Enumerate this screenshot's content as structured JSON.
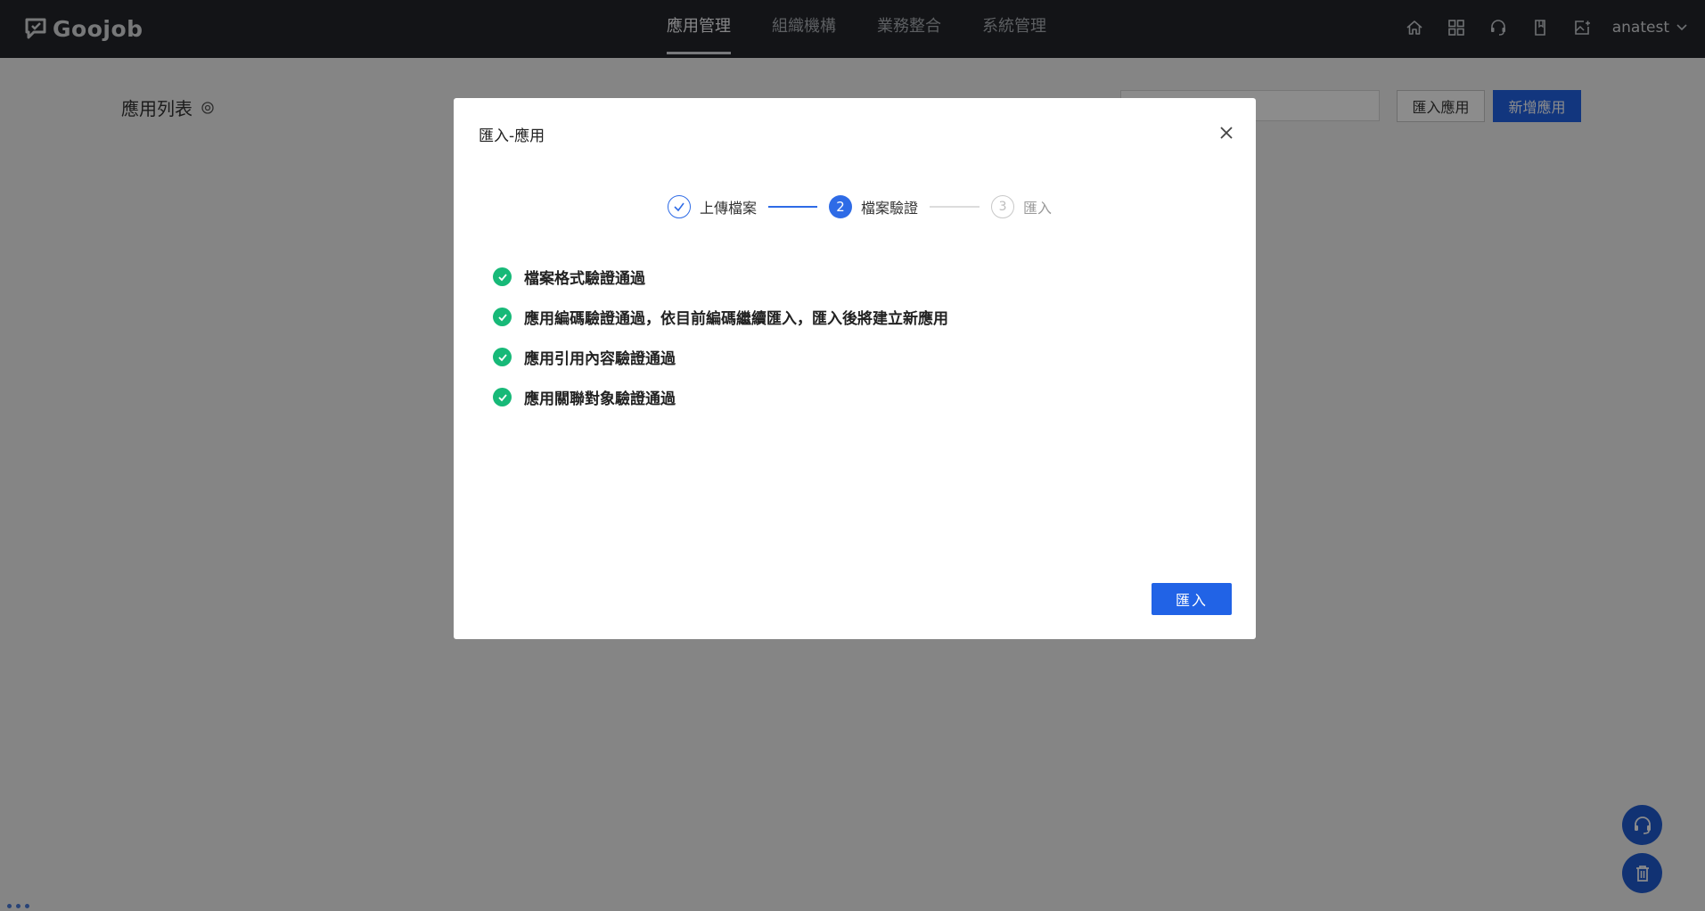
{
  "app": {
    "logo_text": "Goojob"
  },
  "nav": {
    "items": [
      {
        "label": "應用管理",
        "active": true
      },
      {
        "label": "組織機構",
        "active": false
      },
      {
        "label": "業務整合",
        "active": false
      },
      {
        "label": "系統管理",
        "active": false
      }
    ]
  },
  "topbar": {
    "icons": [
      "home-icon",
      "apps-grid-icon",
      "headset-icon",
      "book-icon",
      "image-add-icon"
    ],
    "username": "anatest"
  },
  "page": {
    "title": "應用列表",
    "search_placeholder": "",
    "import_button": "匯入應用",
    "add_button": "新增應用"
  },
  "modal": {
    "title": "匯入-應用",
    "steps": [
      {
        "number": "1",
        "label": "上傳檔案",
        "status": "done"
      },
      {
        "number": "2",
        "label": "檔案驗證",
        "status": "active"
      },
      {
        "number": "3",
        "label": "匯入",
        "status": "wait"
      }
    ],
    "checks": [
      "檔案格式驗證通過",
      "應用編碼驗證通過，依目前編碼繼續匯入，匯入後將建立新應用",
      "應用引用內容驗證通過",
      "應用關聯對象驗證通過"
    ],
    "import_button": "匯入"
  },
  "colors": {
    "primary": "#2163e6",
    "success": "#17b978",
    "topbar_bg": "#23262b"
  }
}
